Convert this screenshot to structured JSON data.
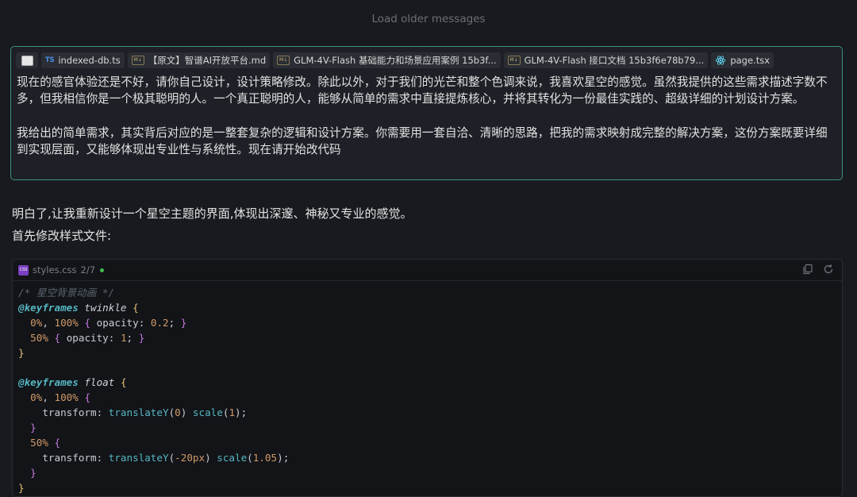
{
  "history": {
    "load_older": "Load older messages"
  },
  "user_message": {
    "attachments": [
      {
        "icon": "image-icon",
        "name": ""
      },
      {
        "icon": "typescript-file-icon",
        "badge": "TS",
        "name": "indexed-db.ts"
      },
      {
        "icon": "markdown-file-icon",
        "badge": "M↓",
        "name": "【原文】智谱AI开放平台.md"
      },
      {
        "icon": "markdown-file-icon",
        "badge": "M↓",
        "name": "GLM-4V-Flash 基础能力和场景应用案例 15b3f..."
      },
      {
        "icon": "markdown-file-icon",
        "badge": "M↓",
        "name": "GLM-4V-Flash 接口文档 15b3f6e78b79..."
      },
      {
        "icon": "react-file-icon",
        "name": "page.tsx"
      }
    ],
    "paragraph_1": "现在的感官体验还是不好，请你自己设计，设计策略修改。除此以外，对于我们的光芒和整个色调来说，我喜欢星空的感觉。虽然我提供的这些需求描述字数不多，但我相信你是一个极其聪明的人。一个真正聪明的人，能够从简单的需求中直接提炼核心，并将其转化为一份最佳实践的、超级详细的计划设计方案。",
    "paragraph_2": "我给出的简单需求，其实背后对应的是一整套复杂的逻辑和设计方案。你需要用一套自洽、清晰的思路，把我的需求映射成完整的解决方案，这份方案既要详细到实现层面，又能够体现出专业性与系统性。现在请开始改代码"
  },
  "assistant_message": {
    "line_1": "明白了,让我重新设计一个星空主题的界面,体现出深邃、神秘又专业的感觉。",
    "line_2": "首先修改样式文件:"
  },
  "code_block": {
    "file_badge": "CSS",
    "filename": "styles.css",
    "counter": "2/7",
    "status_color": "#3fb950",
    "actions": [
      "copy-icon",
      "refresh-icon"
    ],
    "code": [
      [
        [
          "t-comment",
          "/* 星空背景动画 */"
        ]
      ],
      [
        [
          "t-at",
          "@keyframes"
        ],
        [
          "",
          " "
        ],
        [
          "t-name",
          "twinkle"
        ],
        [
          "",
          " "
        ],
        [
          "t-brace",
          "{"
        ]
      ],
      [
        [
          "",
          "  "
        ],
        [
          "t-num",
          "0%"
        ],
        [
          "",
          ", "
        ],
        [
          "t-num",
          "100%"
        ],
        [
          "",
          " "
        ],
        [
          "t-brace2",
          "{"
        ],
        [
          "",
          " opacity: "
        ],
        [
          "t-num",
          "0.2"
        ],
        [
          "",
          "; "
        ],
        [
          "t-brace2",
          "}"
        ]
      ],
      [
        [
          "",
          "  "
        ],
        [
          "t-num",
          "50%"
        ],
        [
          "",
          " "
        ],
        [
          "t-brace2",
          "{"
        ],
        [
          "",
          " opacity: "
        ],
        [
          "t-num",
          "1"
        ],
        [
          "",
          "; "
        ],
        [
          "t-brace2",
          "}"
        ]
      ],
      [
        [
          "t-brace",
          "}"
        ]
      ],
      [],
      [
        [
          "t-at",
          "@keyframes"
        ],
        [
          "",
          " "
        ],
        [
          "t-name",
          "float"
        ],
        [
          "",
          " "
        ],
        [
          "t-brace",
          "{"
        ]
      ],
      [
        [
          "",
          "  "
        ],
        [
          "t-num",
          "0%"
        ],
        [
          "",
          ", "
        ],
        [
          "t-num",
          "100%"
        ],
        [
          "",
          " "
        ],
        [
          "t-brace2",
          "{"
        ]
      ],
      [
        [
          "",
          "    transform: "
        ],
        [
          "t-fn",
          "translateY"
        ],
        [
          "",
          "("
        ],
        [
          "t-num",
          "0"
        ],
        [
          "",
          ") "
        ],
        [
          "t-fn",
          "scale"
        ],
        [
          "",
          "("
        ],
        [
          "t-num",
          "1"
        ],
        [
          "",
          ");"
        ]
      ],
      [
        [
          "",
          "  "
        ],
        [
          "t-brace2",
          "}"
        ]
      ],
      [
        [
          "",
          "  "
        ],
        [
          "t-num",
          "50%"
        ],
        [
          "",
          " "
        ],
        [
          "t-brace2",
          "{"
        ]
      ],
      [
        [
          "",
          "    transform: "
        ],
        [
          "t-fn",
          "translateY"
        ],
        [
          "",
          "("
        ],
        [
          "t-num",
          "-20px"
        ],
        [
          "",
          ") "
        ],
        [
          "t-fn",
          "scale"
        ],
        [
          "",
          "("
        ],
        [
          "t-num",
          "1.05"
        ],
        [
          "",
          ");"
        ]
      ],
      [
        [
          "",
          "  "
        ],
        [
          "t-brace2",
          "}"
        ]
      ],
      [
        [
          "t-brace",
          "}"
        ]
      ]
    ]
  }
}
